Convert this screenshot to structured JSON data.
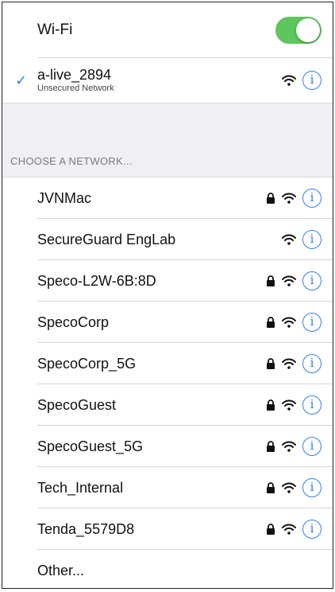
{
  "wifi": {
    "label": "Wi-Fi",
    "enabled": true,
    "toggle_color": "#5dc65d"
  },
  "connected": {
    "name": "a-live_2894",
    "status": "Unsecured Network",
    "checkmark_icon": "checkmark-icon",
    "check_color": "#2f7ff5"
  },
  "section": {
    "header": "CHOOSE A NETWORK..."
  },
  "networks": [
    {
      "name": "JVNMac",
      "locked": true
    },
    {
      "name": "SecureGuard EngLab",
      "locked": false
    },
    {
      "name": "Speco-L2W-6B:8D",
      "locked": true
    },
    {
      "name": "SpecoCorp",
      "locked": true
    },
    {
      "name": "SpecoCorp_5G",
      "locked": true
    },
    {
      "name": "SpecoGuest",
      "locked": true
    },
    {
      "name": "SpecoGuest_5G",
      "locked": true
    },
    {
      "name": "Tech_Internal",
      "locked": true
    },
    {
      "name": "Tenda_5579D8",
      "locked": true
    }
  ],
  "other": {
    "label": "Other..."
  },
  "icons": {
    "lock": "lock-icon",
    "wifi": "wifi-signal-icon",
    "info": "info-icon",
    "info_glyph": "i"
  },
  "colors": {
    "accent": "#2f7ff5",
    "separator": "#d6d6da",
    "section_bg": "#efeff4"
  }
}
